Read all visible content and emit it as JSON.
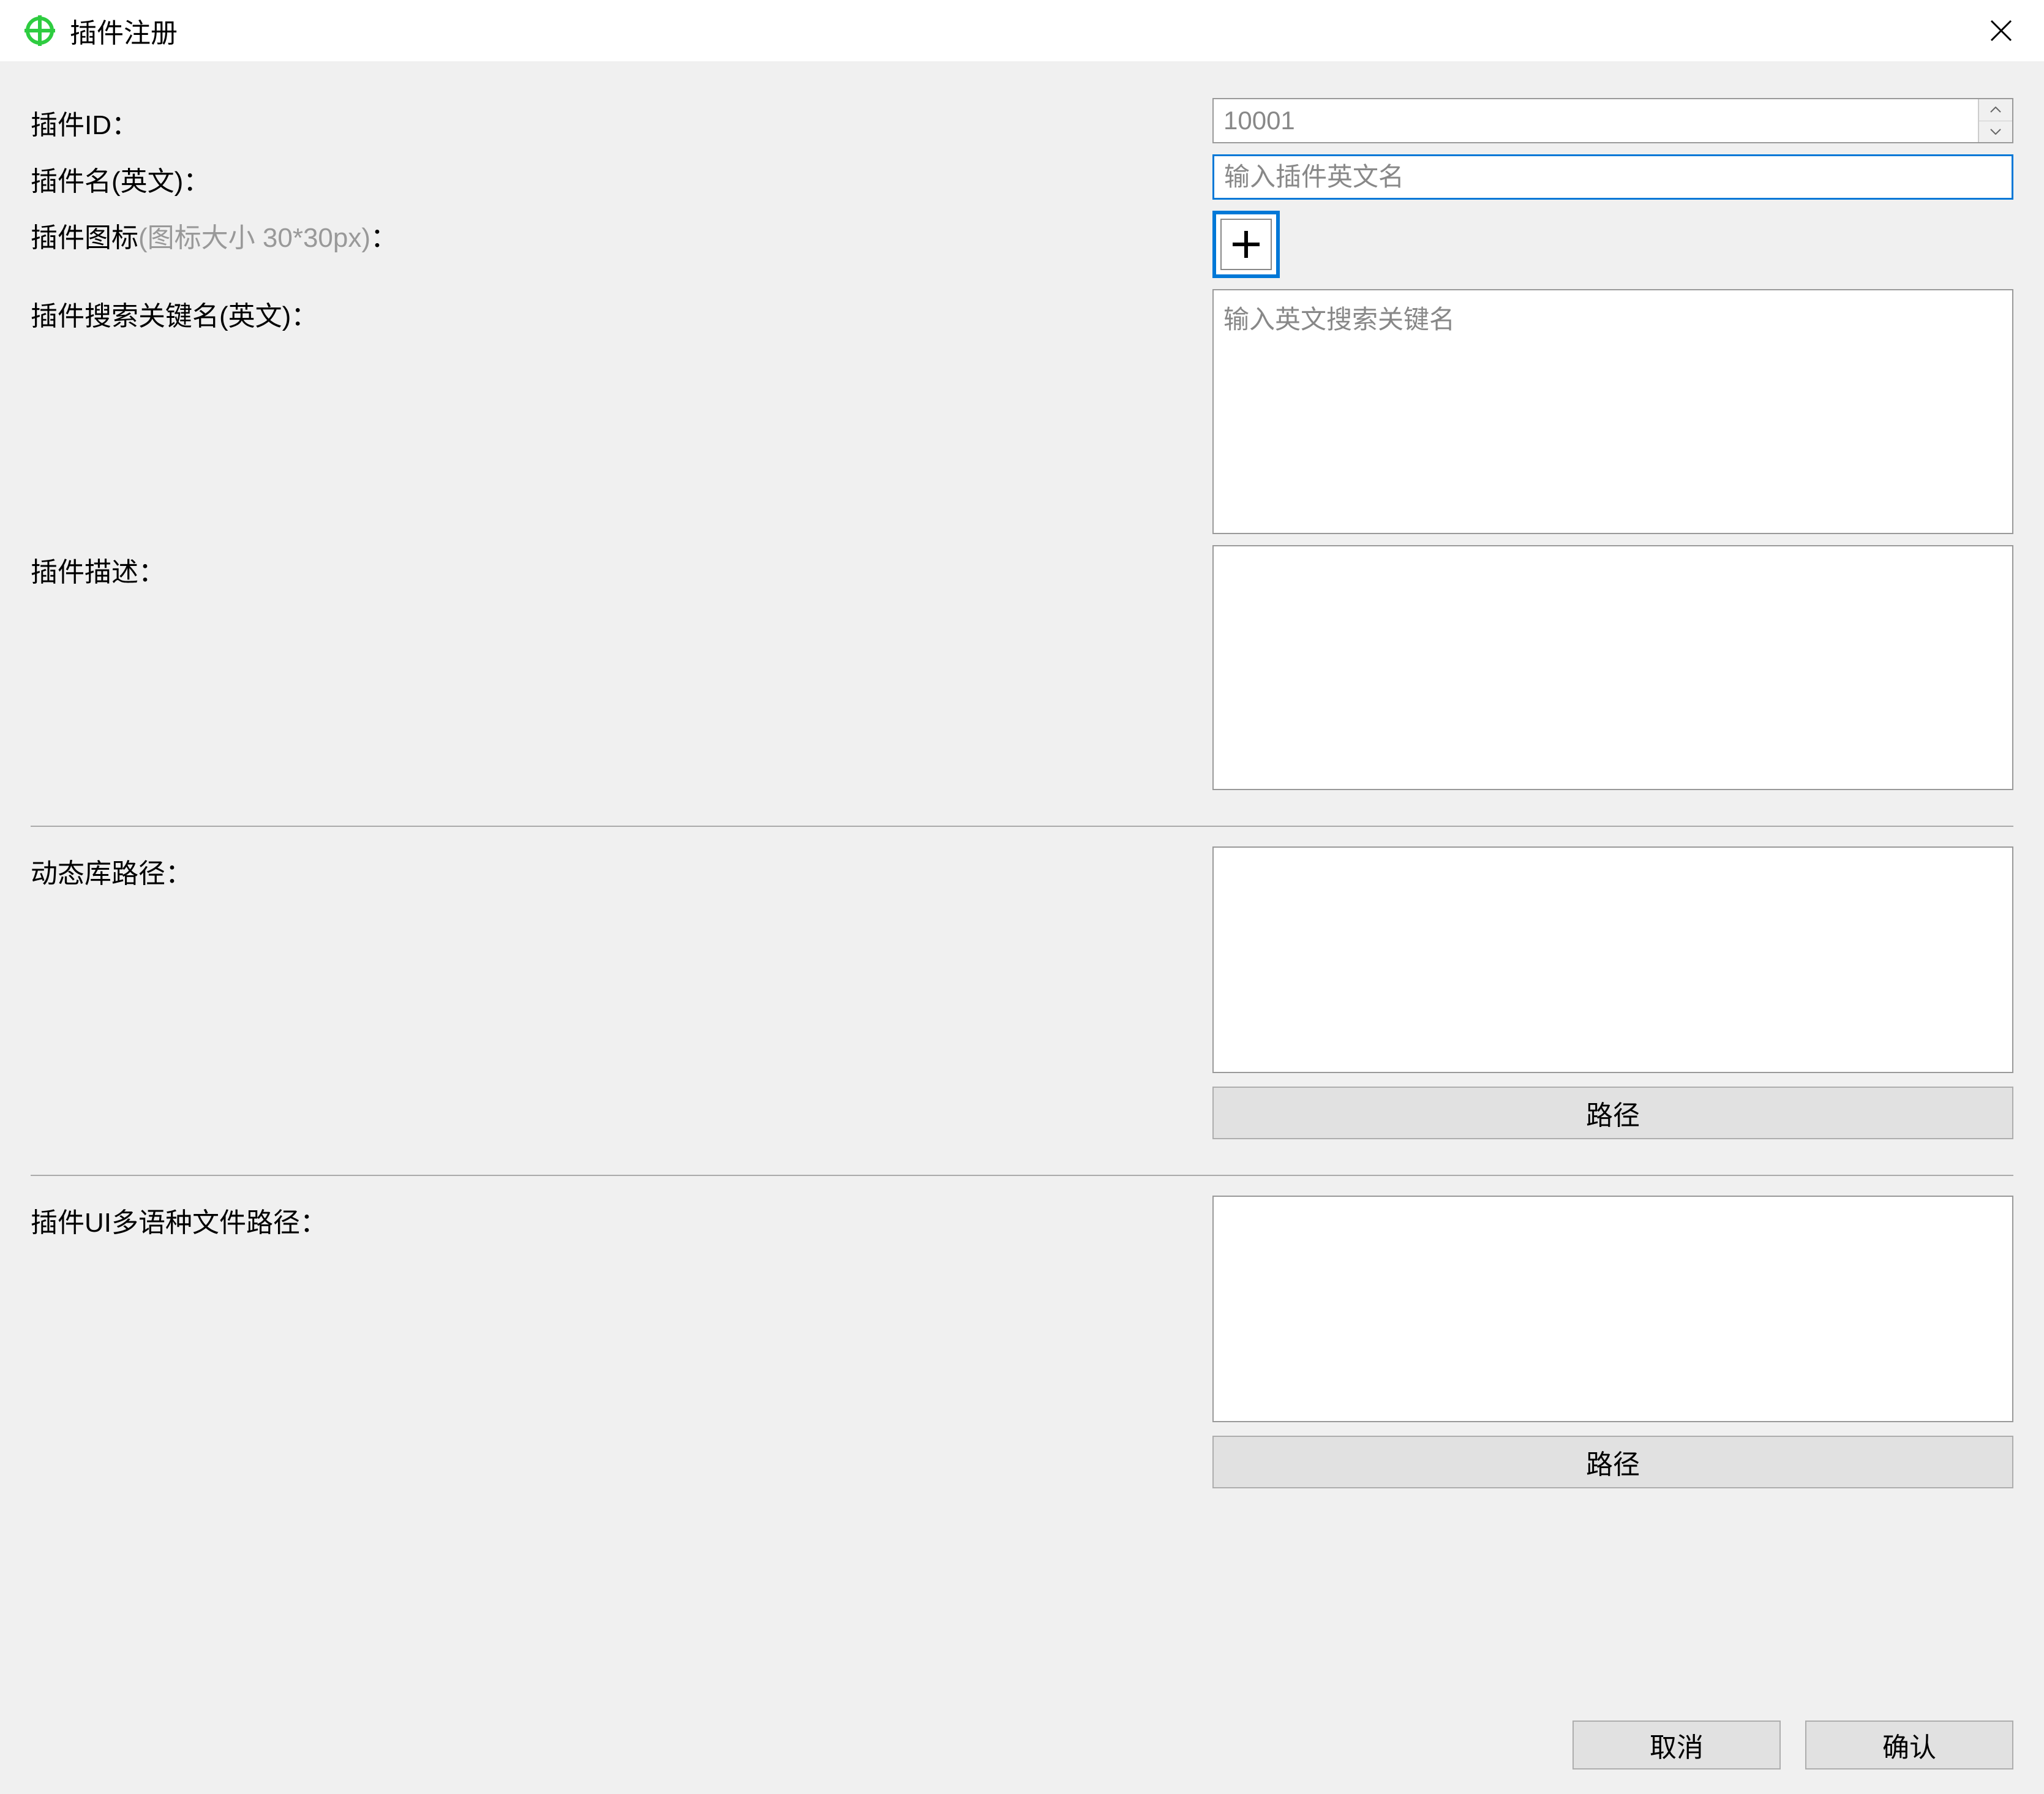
{
  "titlebar": {
    "title": "插件注册"
  },
  "labels": {
    "plugin_id": "插件ID：",
    "plugin_name": "插件名(英文)：",
    "plugin_icon": "插件图标",
    "plugin_icon_hint": "(图标大小 30*30px)",
    "plugin_icon_colon": "：",
    "search_keywords": "插件搜索关键名(英文)：",
    "description": "插件描述：",
    "dll_path": "动态库路径：",
    "ui_lang_path": "插件UI多语种文件路径："
  },
  "fields": {
    "plugin_id_value": "10001",
    "plugin_name_placeholder": "输入插件英文名",
    "search_keywords_placeholder": "输入英文搜索关键名"
  },
  "buttons": {
    "path": "路径",
    "cancel": "取消",
    "confirm": "确认"
  }
}
